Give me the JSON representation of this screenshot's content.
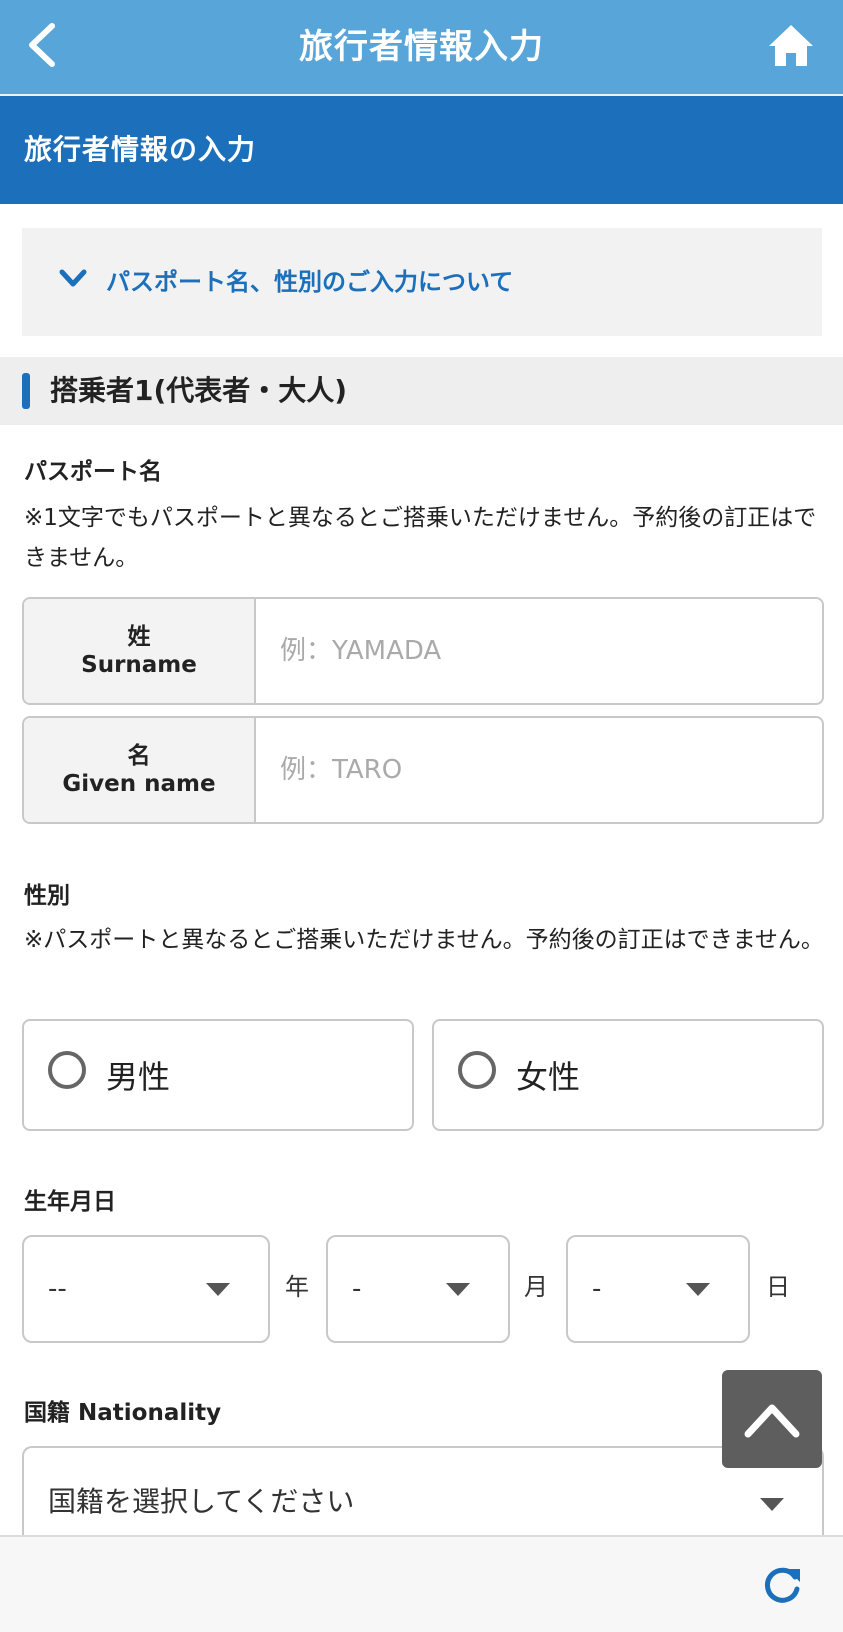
{
  "nav": {
    "title": "旅行者情報入力"
  },
  "section": {
    "title": "旅行者情報の入力"
  },
  "accordion": {
    "label": "パスポート名、性別のご入力について"
  },
  "passenger": {
    "title": "搭乗者1(代表者・大人)",
    "passport_name": {
      "label": "パスポート名",
      "note": "※1文字でもパスポートと異なるとご搭乗いただけません。予約後の訂正はできません。",
      "surname": {
        "label_jp": "姓",
        "label_en": "Surname",
        "placeholder": "例：YAMADA",
        "value": ""
      },
      "given": {
        "label_jp": "名",
        "label_en": "Given name",
        "placeholder": "例：TARO",
        "value": ""
      }
    },
    "gender": {
      "label": "性別",
      "note": "※パスポートと異なるとご搭乗いただけません。予約後の訂正はできません。",
      "male": "男性",
      "female": "女性"
    },
    "birthdate": {
      "label": "生年月日",
      "year_value": "--",
      "year_unit": "年",
      "month_value": "-",
      "month_unit": "月",
      "day_value": "-",
      "day_unit": "日"
    },
    "nationality": {
      "label": "国籍 Nationality",
      "placeholder": "国籍を選択してください"
    }
  },
  "icons": {
    "back": "chevron-left-icon",
    "home": "home-icon",
    "accordion": "chevron-down-icon",
    "scroll_top": "chevron-up-icon",
    "reload": "reload-icon"
  },
  "colors": {
    "topbar": "#57a5d9",
    "section": "#1c6fba",
    "accent": "#1c6fba",
    "scroll_button": "#5e5e5e"
  }
}
